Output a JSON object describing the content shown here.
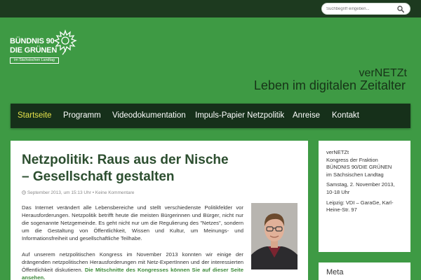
{
  "search": {
    "placeholder": "Suchbegriff eingeben..."
  },
  "logo": {
    "line1": "BÜNDNIS 90",
    "line2": "DIE GRÜNEN",
    "line3": "im Sächsischen Landtag"
  },
  "site": {
    "title": "verNETZt",
    "tagline": "Leben im digitalen Zeitalter"
  },
  "nav": {
    "items": [
      {
        "label": "Startseite",
        "active": true
      },
      {
        "label": "Programm"
      },
      {
        "label": "Videodokumentation"
      },
      {
        "label": "Impuls-Papier Netzpolitik"
      },
      {
        "label": "Anreise"
      },
      {
        "label": "Kontakt"
      }
    ]
  },
  "post": {
    "title": "Netzpolitik: Raus aus der Nische – Gesellschaft gestalten",
    "date": "September 2013, um 15:13 Uhr",
    "separator": "•",
    "comments": "Keine Kommentare",
    "para1": "Das Internet verändert alle Lebensbereiche und stellt verschiedenste Politikfelder vor Herausforderungen. Netzpolitik betrifft heute die meisten Bürgerinnen und Bürger, nicht nur die sogenannte Netzgemeinde. Es geht nicht nur um die Regulierung des \"Netzes\", sondern um die Gestaltung von Öffentlichkeit, Wissen und Kultur, um Meinungs- und Informationsfreiheit und gesellschaftliche Teilhabe.",
    "para2": "Auf unserem netzpolitischen Kongress im November 2013 konnten wir einige der drängenden netzpolitischen Herausforderungen mit Netz-ExpertInnen und der interessierten Öffentlichkeit diskutieren.",
    "para2_link": "Die Mitschnitte des Kongresses können Sie auf dieser Seite ansehen."
  },
  "sidebar": {
    "event": {
      "l1": "verNETZt",
      "l2": "Kongress der Fraktion",
      "l3": "BÜNDNIS 90/DIE GRÜNEN",
      "l4": "im Sächsischen Landtag",
      "date": "Samstag, 2. November 2013, 10-18 Uhr",
      "place": "Leipzig: VDI – GaraGe, Karl-Heine-Str. 97"
    },
    "meta_title": "Meta"
  },
  "colors": {
    "page_green": "#3e9a44",
    "topbar": "#1d3a1f",
    "nav_bg": "#16301a",
    "nav_active": "#e6e24a",
    "title_green": "#2c4e2f",
    "link_green": "#3e8a3a"
  },
  "icons": [
    "search-icon",
    "sunflower-icon",
    "clock-icon"
  ]
}
